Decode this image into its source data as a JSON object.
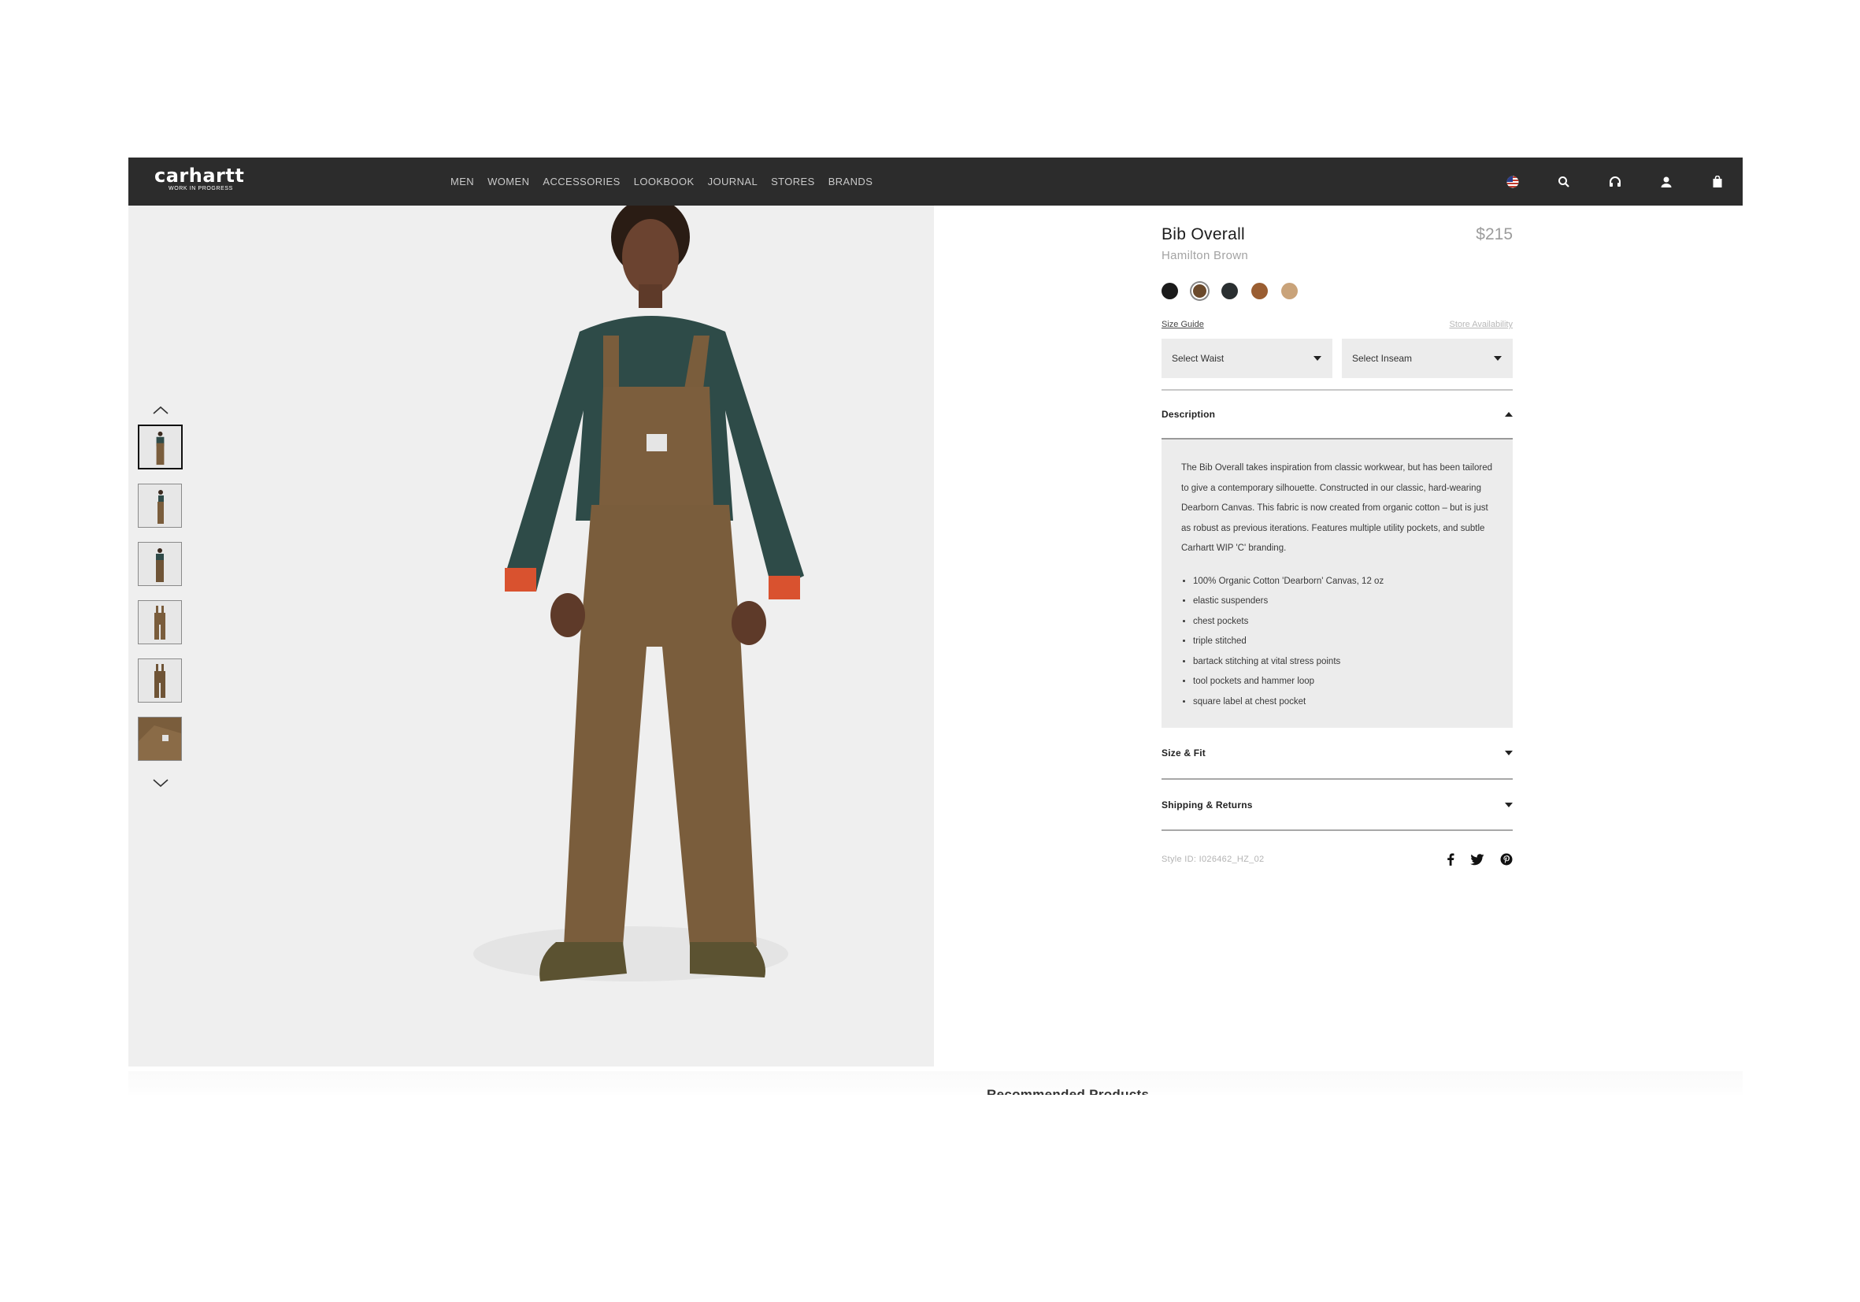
{
  "brand": {
    "logo_text": "carhartt",
    "tagline": "WORK IN PROGRESS"
  },
  "nav": {
    "items": [
      "MEN",
      "WOMEN",
      "ACCESSORIES",
      "LOOKBOOK",
      "JOURNAL",
      "STORES",
      "BRANDS"
    ],
    "icons": [
      "us-flag-icon",
      "search-icon",
      "headphones-icon",
      "user-icon",
      "bag-icon"
    ]
  },
  "gallery": {
    "thumbnail_count": 6,
    "active_thumbnail": 1
  },
  "product": {
    "name": "Bib Overall",
    "price": "$215",
    "color_name": "Hamilton Brown",
    "swatches": [
      {
        "color": "#1b1b1b",
        "selected": false
      },
      {
        "color": "#6b4a2c",
        "selected": true
      },
      {
        "color": "#2a2f31",
        "selected": false
      },
      {
        "color": "#9a5e32",
        "selected": false
      },
      {
        "color": "#c9a37a",
        "selected": false
      }
    ],
    "size_guide_label": "Size Guide",
    "store_availability_label": "Store Availability",
    "waist_placeholder": "Select Waist",
    "inseam_placeholder": "Select Inseam"
  },
  "description": {
    "title": "Description",
    "text": "The Bib Overall takes inspiration from classic workwear, but has been tailored to give a contemporary silhouette. Constructed in our classic, hard-wearing Dearborn Canvas. This fabric is now created from organic cotton – but is just as robust as previous iterations. Features multiple utility pockets, and subtle Carhartt WIP 'C' branding.",
    "bullets": [
      "100% Organic Cotton 'Dearborn' Canvas, 12 oz",
      "elastic suspenders",
      "chest pockets",
      "triple stitched",
      "bartack stitching at vital stress points",
      "tool pockets and hammer loop",
      "square label at chest pocket"
    ]
  },
  "size_fit": {
    "title": "Size & Fit"
  },
  "shipping": {
    "title": "Shipping & Returns"
  },
  "style_id": "Style ID: I026462_HZ_02",
  "recommended": {
    "title": "Recommended Products"
  }
}
